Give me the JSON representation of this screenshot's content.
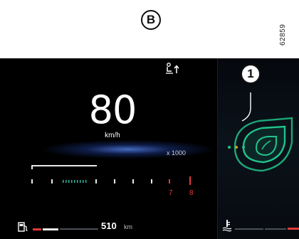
{
  "figure": {
    "badge_label": "B",
    "reference_number": "62859",
    "callout_number": "1"
  },
  "cluster": {
    "speed_value": "80",
    "speed_unit": "km/h",
    "rpm_multiplier": "x 1000",
    "gear_labels": [
      "7",
      "8"
    ],
    "range_value": "510",
    "range_unit": "km",
    "fuel_level_fraction": 0.22,
    "icons": [
      "seat-adjust-icon",
      "fuel-pump-icon",
      "coolant-temperature-icon",
      "eco-leaf-icon"
    ],
    "colors": {
      "background": "#000000",
      "speed_glow": "#5a8cff",
      "eco_green": "#21c28a",
      "rev_active": "#2fb8a0",
      "warning_red": "#e23a3a"
    }
  }
}
